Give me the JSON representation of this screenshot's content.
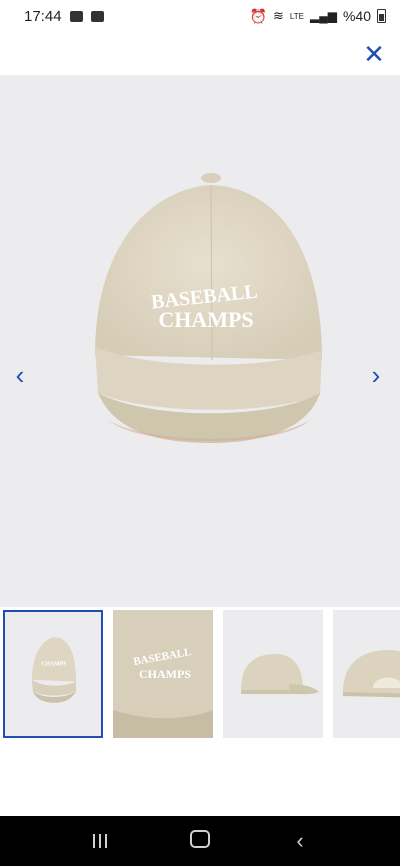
{
  "status_bar": {
    "time": "17:44",
    "battery_text": "%40",
    "network_label": "LTE",
    "left_icons": [
      "photo-icon",
      "app-icon"
    ],
    "right_icons": [
      "alarm-icon",
      "wifi-icon",
      "signal-icon",
      "battery-icon"
    ]
  },
  "viewer": {
    "close_icon": "close-icon",
    "prev_icon": "chevron-left-icon",
    "next_icon": "chevron-right-icon",
    "cap_text_line1": "BASEBALL",
    "cap_text_line2": "CHAMPS",
    "cap_color": "#e0d8c5",
    "accent_color": "#1f4fb4"
  },
  "thumbnails": [
    {
      "name": "thumbnail-front",
      "selected": true
    },
    {
      "name": "thumbnail-closeup",
      "selected": false
    },
    {
      "name": "thumbnail-side",
      "selected": false
    },
    {
      "name": "thumbnail-back",
      "selected": false
    }
  ],
  "system_nav": [
    "recents-icon",
    "home-icon",
    "back-icon"
  ]
}
